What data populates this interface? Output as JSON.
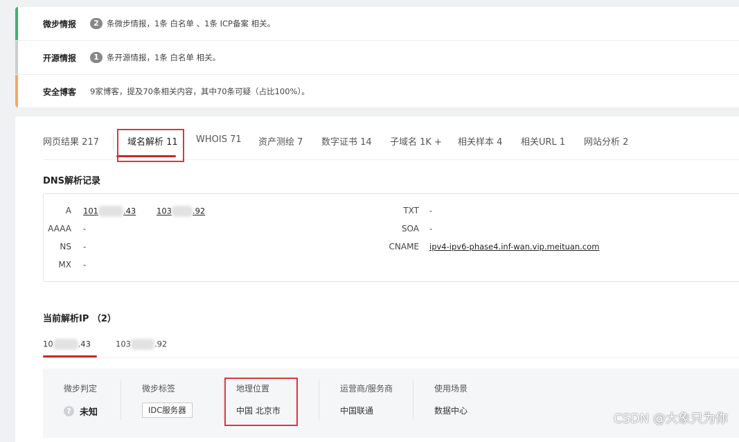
{
  "intel": [
    {
      "label": "微步情报",
      "badge": "2",
      "text": "条微步情报，1条 白名单 、1条 ICP备案 相关。",
      "color": "#3cb371"
    },
    {
      "label": "开源情报",
      "badge": "1",
      "text": "条开源情报，1条 白名单 相关。",
      "color": "#cccccc"
    },
    {
      "label": "安全博客",
      "badge": "",
      "text": "9家博客，提及70条相关内容，其中70条可疑（占比100%）。",
      "color": "#f0a868"
    }
  ],
  "tabs": [
    {
      "label": "网页结果 217"
    },
    {
      "label": "域名解析 11"
    },
    {
      "label": "WHOIS 71"
    },
    {
      "label": "资产测绘 7"
    },
    {
      "label": "数字证书 14"
    },
    {
      "label": "子域名 1K +"
    },
    {
      "label": "相关样本 4"
    },
    {
      "label": "相关URL 1"
    },
    {
      "label": "网站分析 2"
    }
  ],
  "active_tab": "域名解析 11",
  "dns": {
    "title": "DNS解析记录",
    "a_key": "A",
    "a_ip1_pre": "101",
    "a_ip1_post": ".43",
    "a_ip2_pre": "103",
    "a_ip2_post": ".92",
    "aaaa_key": "AAAA",
    "aaaa_val": "-",
    "ns_key": "NS",
    "ns_val": "-",
    "mx_key": "MX",
    "mx_val": "-",
    "txt_key": "TXT",
    "txt_val": "-",
    "soa_key": "SOA",
    "soa_val": "-",
    "cname_key": "CNAME",
    "cname_val": "ipv4-ipv6-phase4.inf-wan.vip.meituan.com"
  },
  "current_ip": {
    "title": "当前解析IP （2）",
    "ip1_pre": "10",
    "ip1_post": ".43",
    "ip2_pre": "103",
    "ip2_post": ".92"
  },
  "detail": {
    "judge_head": "微步判定",
    "judge_val": "未知",
    "judge_icon": "?",
    "tag_head": "微步标签",
    "tag_val": "IDC服务器",
    "geo_head": "地理位置",
    "geo_val": "中国 北京市",
    "isp_head": "运营商/服务商",
    "isp_val": "中国联通",
    "scene_head": "使用场景",
    "scene_val": "数据中心"
  },
  "watermark": "CSDN @大象只为你",
  "colors": {
    "accent": "#c62828",
    "highlight_box": "#d9363e"
  }
}
